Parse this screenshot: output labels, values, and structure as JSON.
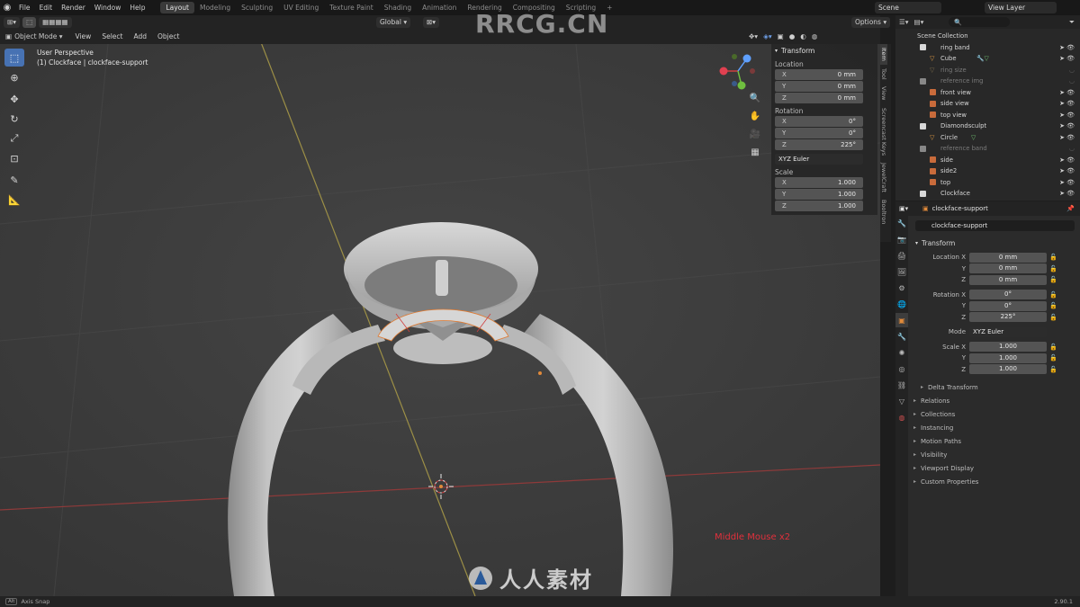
{
  "topbar": {
    "menus": [
      "File",
      "Edit",
      "Render",
      "Window",
      "Help"
    ],
    "workspaces": [
      "Layout",
      "Modeling",
      "Sculpting",
      "UV Editing",
      "Texture Paint",
      "Shading",
      "Animation",
      "Rendering",
      "Compositing",
      "Scripting"
    ],
    "active_workspace": "Layout",
    "add_tab": "+",
    "scene": "Scene",
    "view_layer": "View Layer"
  },
  "viewport_header": {
    "mode": "Object Mode",
    "menus": [
      "View",
      "Select",
      "Add",
      "Object"
    ],
    "orientation": "Global",
    "options": "Options"
  },
  "viewport": {
    "view_name": "User Perspective",
    "active_object": "(1) Clockface | clockface-support",
    "overlay_text": "Middle Mouse x2",
    "overlay_color": "#e0303c"
  },
  "npanel": {
    "title": "Transform",
    "location_label": "Location",
    "location": [
      {
        "axis": "X",
        "value": "0 mm"
      },
      {
        "axis": "Y",
        "value": "0 mm"
      },
      {
        "axis": "Z",
        "value": "0 mm"
      }
    ],
    "rotation_label": "Rotation",
    "rotation": [
      {
        "axis": "X",
        "value": "0°"
      },
      {
        "axis": "Y",
        "value": "0°"
      },
      {
        "axis": "Z",
        "value": "225°"
      }
    ],
    "rotation_mode": "XYZ Euler",
    "scale_label": "Scale",
    "scale": [
      {
        "axis": "X",
        "value": "1.000"
      },
      {
        "axis": "Y",
        "value": "1.000"
      },
      {
        "axis": "Z",
        "value": "1.000"
      }
    ],
    "tabs": [
      "Item",
      "Tool",
      "View",
      "Screencast Keys",
      "JewelCraft",
      "Booltron"
    ]
  },
  "outliner": {
    "search_placeholder": "",
    "rows": [
      {
        "name": "Scene Collection",
        "type": "scene"
      },
      {
        "name": "ring band",
        "type": "collection"
      },
      {
        "name": "Cube",
        "type": "mesh"
      },
      {
        "name": "ring size",
        "type": "mesh-dim"
      },
      {
        "name": "reference img",
        "type": "collection-dim"
      },
      {
        "name": "front view",
        "type": "image"
      },
      {
        "name": "side view",
        "type": "image"
      },
      {
        "name": "top view",
        "type": "image"
      },
      {
        "name": "Diamondsculpt",
        "type": "collection"
      },
      {
        "name": "Circle",
        "type": "mesh"
      },
      {
        "name": "reference band",
        "type": "collection-dim"
      },
      {
        "name": "side",
        "type": "image"
      },
      {
        "name": "side2",
        "type": "image"
      },
      {
        "name": "top",
        "type": "image"
      },
      {
        "name": "Clockface",
        "type": "collection"
      }
    ]
  },
  "properties": {
    "header_object": "clockface-support",
    "object_name": "clockface-support",
    "transform_title": "Transform",
    "location_label": "Location X",
    "location": [
      "0 mm",
      "0 mm",
      "0 mm"
    ],
    "rotation_label": "Rotation X",
    "rotation": [
      "0°",
      "0°",
      "225°"
    ],
    "mode_label": "Mode",
    "mode": "XYZ Euler",
    "scale_label": "Scale X",
    "scale": [
      "1.000",
      "1.000",
      "1.000"
    ],
    "axis_y": "Y",
    "axis_z": "Z",
    "delta_transform": "Delta Transform",
    "sections": [
      "Relations",
      "Collections",
      "Instancing",
      "Motion Paths",
      "Visibility",
      "Viewport Display",
      "Custom Properties"
    ]
  },
  "statusbar": {
    "left": "Axis Snap",
    "version": "2.90.1"
  },
  "watermark": {
    "top": "RRCG.CN",
    "bottom": "人人素材"
  }
}
